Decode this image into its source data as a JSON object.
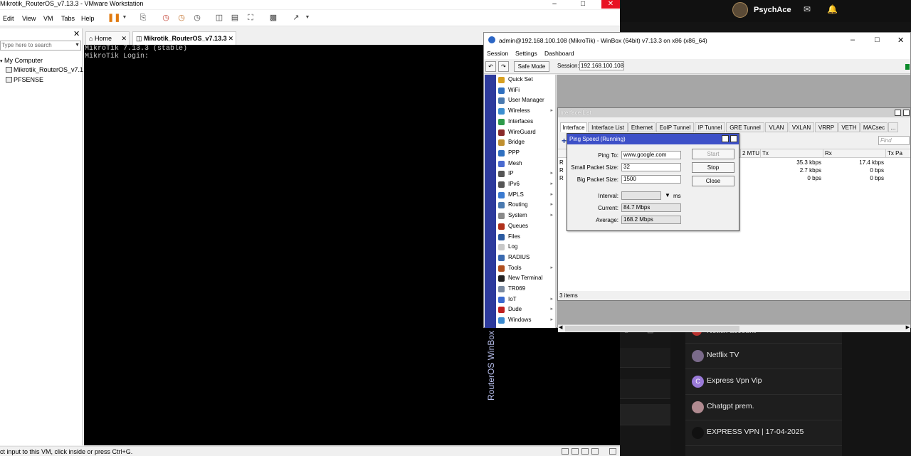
{
  "vmware": {
    "title": "Mikrotik_RouterOS_v7.13.3 - VMware Workstation",
    "menu": [
      "Edit",
      "View",
      "VM",
      "Tabs",
      "Help"
    ],
    "library": {
      "search_placeholder": "Type here to search",
      "tree": [
        "My Computer",
        "Mikrotik_RouterOS_v7.1",
        "PFSENSE"
      ]
    },
    "tabs": [
      {
        "label": "Home"
      },
      {
        "label": "Mikrotik_RouterOS_v7.13.3",
        "active": true
      }
    ],
    "console_lines": [
      "MikroTik 7.13.3 (stable)",
      "MikroTik Login:"
    ],
    "status": "ct input to this VM, click inside or press Ctrl+G."
  },
  "background_app": {
    "brand": "PsychAce",
    "list_items": [
      {
        "label": "Netflix account",
        "color": "#b8322f"
      },
      {
        "label": "Netflix TV",
        "color": "#7a6a8a"
      },
      {
        "label": "Express Vpn Vip",
        "color": "#9a7ad8",
        "initial": "C"
      },
      {
        "label": "Chatgpt prem.",
        "color": "#b08a90"
      },
      {
        "label": "EXPRESS VPN | 17-04-2025",
        "color": "#111111"
      }
    ]
  },
  "winbox": {
    "title": "admin@192.168.100.108 (MikroTik) - WinBox (64bit) v7.13.3 on x86 (x86_64)",
    "menu": [
      "Session",
      "Settings",
      "Dashboard"
    ],
    "safe_mode": "Safe Mode",
    "session_label": "Session:",
    "session_value": "192.168.100.108",
    "side_text": "RouterOS WinBox",
    "nav": [
      {
        "label": "Quick Set",
        "color": "#d8a020"
      },
      {
        "label": "WiFi",
        "color": "#3070c0"
      },
      {
        "label": "User Manager",
        "color": "#4a7ab0"
      },
      {
        "label": "Wireless",
        "color": "#3b8ed0",
        "sub": true
      },
      {
        "label": "Interfaces",
        "color": "#2e9a4a"
      },
      {
        "label": "WireGuard",
        "color": "#8a2a2a"
      },
      {
        "label": "Bridge",
        "color": "#c09030"
      },
      {
        "label": "PPP",
        "color": "#3070c0"
      },
      {
        "label": "Mesh",
        "color": "#4a6ad0"
      },
      {
        "label": "IP",
        "color": "#555555",
        "sub": true
      },
      {
        "label": "IPv6",
        "color": "#555555",
        "sub": true
      },
      {
        "label": "MPLS",
        "color": "#3a7ad0",
        "sub": true
      },
      {
        "label": "Routing",
        "color": "#4a7ab0",
        "sub": true
      },
      {
        "label": "System",
        "color": "#8a8a8a",
        "sub": true
      },
      {
        "label": "Queues",
        "color": "#b0301a"
      },
      {
        "label": "Files",
        "color": "#2a5aa0"
      },
      {
        "label": "Log",
        "color": "#c8c8c8"
      },
      {
        "label": "RADIUS",
        "color": "#3a6ab0"
      },
      {
        "label": "Tools",
        "color": "#b05020",
        "sub": true
      },
      {
        "label": "New Terminal",
        "color": "#222222"
      },
      {
        "label": "TR069",
        "color": "#7a8aa0"
      },
      {
        "label": "IoT",
        "color": "#3a6ad0",
        "sub": true
      },
      {
        "label": "Dude",
        "color": "#c02020",
        "sub": true
      },
      {
        "label": "Windows",
        "color": "#3a8ad0",
        "sub": true
      }
    ]
  },
  "interface_list": {
    "title": "Interface List",
    "tabs": [
      "Interface",
      "Interface List",
      "Ethernet",
      "EoIP Tunnel",
      "IP Tunnel",
      "GRE Tunnel",
      "VLAN",
      "VXLAN",
      "VRRP",
      "VETH",
      "MACsec",
      "..."
    ],
    "find_placeholder": "Find",
    "columns": [
      "2 MTU",
      "Tx",
      "Rx",
      "Tx Pa"
    ],
    "rows": [
      {
        "flag": "R",
        "tx": "35.3 kbps",
        "rx": "17.4 kbps"
      },
      {
        "flag": "R",
        "tx": "2.7 kbps",
        "rx": "0 bps"
      },
      {
        "flag": "R",
        "tx": "0 bps",
        "rx": "0 bps"
      }
    ],
    "count": "3 items"
  },
  "ping_dialog": {
    "title": "Ping Speed (Running)",
    "ping_to_label": "Ping To:",
    "ping_to": "www.google.com",
    "small_label": "Small Packet Size:",
    "small": "32",
    "big_label": "Big Packet Size:",
    "big": "1500",
    "interval_label": "Interval:",
    "interval_unit": "ms",
    "current_label": "Current:",
    "current": "84.7 Mbps",
    "average_label": "Average:",
    "average": "168.2 Mbps",
    "buttons": [
      "Start",
      "Stop",
      "Close"
    ]
  }
}
